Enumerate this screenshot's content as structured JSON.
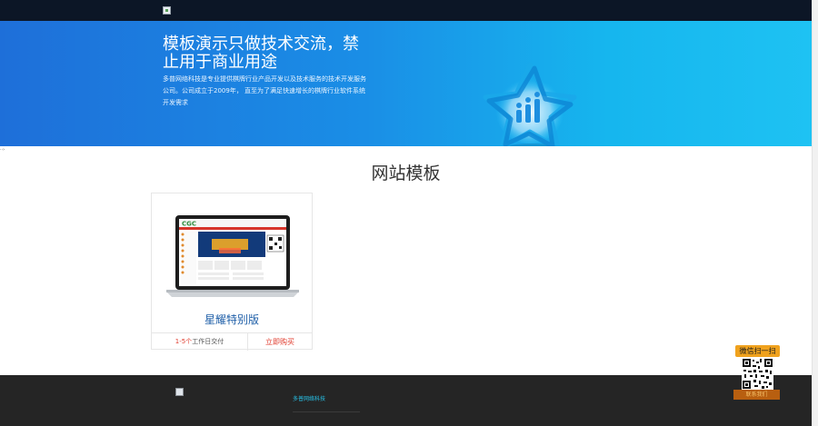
{
  "header": {
    "logo_alt": ""
  },
  "hero": {
    "title": "模板演示只做技术交流，禁止用于商业用途",
    "description": "多普网络科技是专业提供棋牌行业产品开发以及技术服务的技术开发服务公司。公司成立于2009年， 直至为了满足快速增长的棋牌行业软件系统开发需求",
    "graphic_icon": "logo-star-icon",
    "accent": "#1e6fd9"
  },
  "main": {
    "section_title": "网站模板",
    "products": [
      {
        "name": "星耀特别版",
        "preview_logo_text": "CGC",
        "delivery_highlight": "1-5个",
        "delivery_text": "工作日交付",
        "buy_label": "立即购买"
      }
    ]
  },
  "footer": {
    "company": "多普网络科技"
  },
  "qr": {
    "title": "微信扫一扫",
    "subtitle": "联系我们"
  },
  "colors": {
    "dark_bar": "#0c1626",
    "footer_bg": "#252525",
    "red": "#e03b2d",
    "link_blue": "#1f5fa8",
    "qr_orange": "#f0a21e"
  }
}
